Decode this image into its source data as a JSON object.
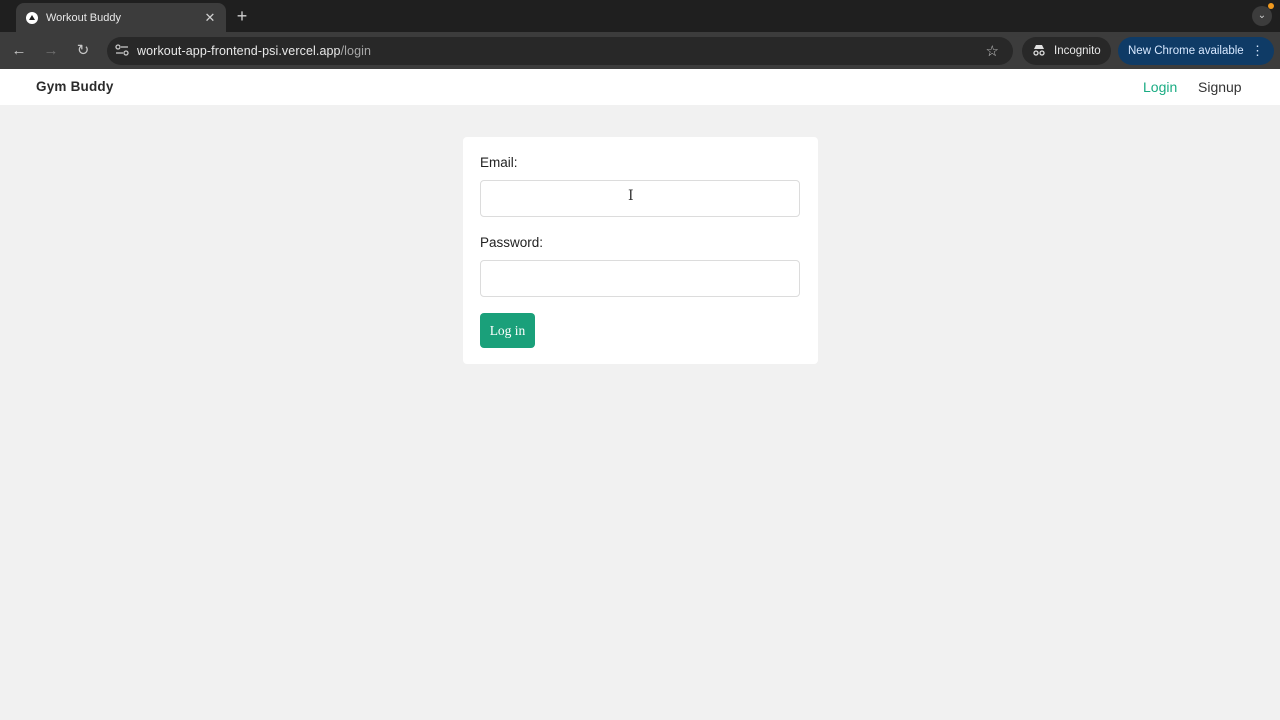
{
  "browser": {
    "tab_title": "Workout Buddy",
    "tab_close": "✕",
    "new_tab": "+",
    "url_host": "workout-app-frontend-psi.vercel.app",
    "url_path": "/login",
    "incognito_label": "Incognito",
    "update_label": "New Chrome available",
    "back": "←",
    "forward": "→",
    "reload": "↻",
    "bookmark_star": "☆",
    "menu_dots": "⋮",
    "tab_search": "⌄"
  },
  "site": {
    "brand": "Gym Buddy",
    "nav": {
      "login": "Login",
      "signup": "Signup"
    },
    "accent_color": "#1aac83"
  },
  "form": {
    "email_label": "Email:",
    "email_value": "",
    "password_label": "Password:",
    "password_value": "",
    "submit_label": "Log in"
  },
  "icons": {
    "site_info": "site-info-icon",
    "incognito": "incognito-icon",
    "text_cursor": "text-cursor-icon"
  }
}
